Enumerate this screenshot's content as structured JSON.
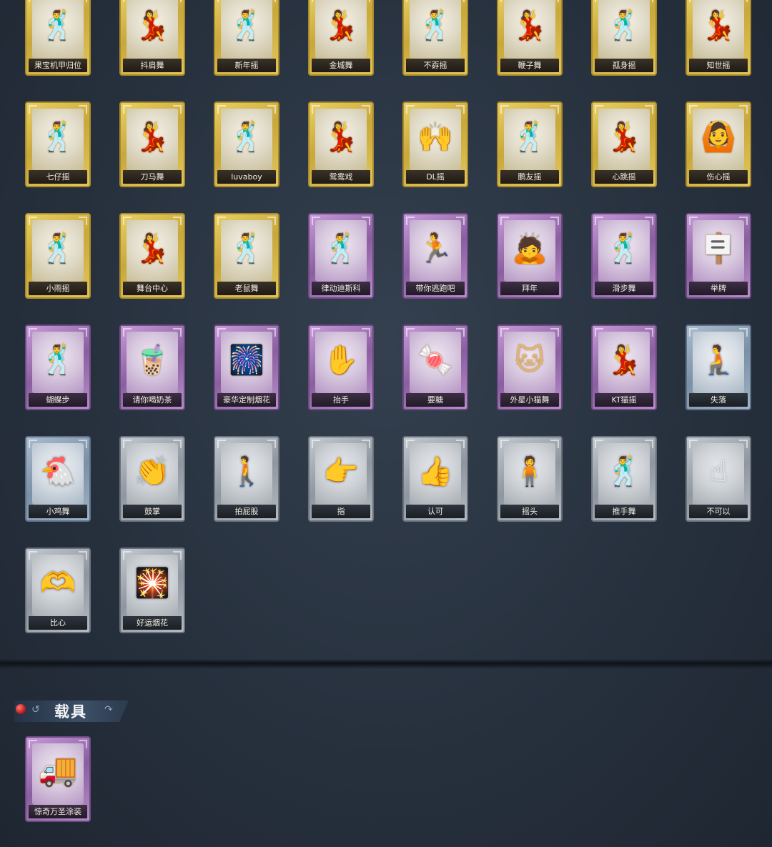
{
  "emotes": [
    {
      "label": "果宝机甲归位",
      "rarity": "gold",
      "icon": "🕺"
    },
    {
      "label": "抖肩舞",
      "rarity": "gold",
      "icon": "💃"
    },
    {
      "label": "新年摇",
      "rarity": "gold",
      "icon": "🕺"
    },
    {
      "label": "金城舞",
      "rarity": "gold",
      "icon": "💃"
    },
    {
      "label": "不孬摇",
      "rarity": "gold",
      "icon": "🕺"
    },
    {
      "label": "鞭子舞",
      "rarity": "gold",
      "icon": "💃"
    },
    {
      "label": "孤身摇",
      "rarity": "gold",
      "icon": "🕺"
    },
    {
      "label": "知世摇",
      "rarity": "gold",
      "icon": "💃"
    },
    {
      "label": "七仔摇",
      "rarity": "gold",
      "icon": "🕺"
    },
    {
      "label": "刀马舞",
      "rarity": "gold",
      "icon": "💃"
    },
    {
      "label": "luvaboy",
      "rarity": "gold",
      "icon": "🕺"
    },
    {
      "label": "鸳鸯戏",
      "rarity": "gold",
      "icon": "💃"
    },
    {
      "label": "DL摇",
      "rarity": "gold",
      "icon": "🙌"
    },
    {
      "label": "鹏友摇",
      "rarity": "gold",
      "icon": "🕺"
    },
    {
      "label": "心跳摇",
      "rarity": "gold",
      "icon": "💃"
    },
    {
      "label": "伤心摇",
      "rarity": "gold",
      "icon": "🙆"
    },
    {
      "label": "小雨摇",
      "rarity": "gold",
      "icon": "🕺"
    },
    {
      "label": "舞台中心",
      "rarity": "gold",
      "icon": "💃"
    },
    {
      "label": "老鼠舞",
      "rarity": "gold",
      "icon": "🕺"
    },
    {
      "label": "律动迪斯科",
      "rarity": "purple",
      "icon": "🕺"
    },
    {
      "label": "带你逃跑吧",
      "rarity": "purple",
      "icon": "🏃"
    },
    {
      "label": "拜年",
      "rarity": "purple",
      "icon": "🙇"
    },
    {
      "label": "滑步舞",
      "rarity": "purple",
      "icon": "🕺"
    },
    {
      "label": "举牌",
      "rarity": "purple",
      "icon": "🪧"
    },
    {
      "label": "蝴蝶步",
      "rarity": "purple",
      "icon": "🕺"
    },
    {
      "label": "请你喝奶茶",
      "rarity": "purple",
      "icon": "🧋"
    },
    {
      "label": "豪华定制烟花",
      "rarity": "purple",
      "icon": "🎆"
    },
    {
      "label": "抬手",
      "rarity": "purple",
      "icon": "✋"
    },
    {
      "label": "要糖",
      "rarity": "purple",
      "icon": "🍬"
    },
    {
      "label": "外星小猫舞",
      "rarity": "purple",
      "icon": "🐱"
    },
    {
      "label": "KT猫摇",
      "rarity": "purple",
      "icon": "💃"
    },
    {
      "label": "失落",
      "rarity": "blue",
      "icon": "🧎"
    },
    {
      "label": "小鸡舞",
      "rarity": "blue",
      "icon": "🐔"
    },
    {
      "label": "鼓掌",
      "rarity": "silver",
      "icon": "👏"
    },
    {
      "label": "拍屁股",
      "rarity": "silver",
      "icon": "🚶"
    },
    {
      "label": "指",
      "rarity": "silver",
      "icon": "👉"
    },
    {
      "label": "认可",
      "rarity": "silver",
      "icon": "👍"
    },
    {
      "label": "摇头",
      "rarity": "silver",
      "icon": "🧍"
    },
    {
      "label": "推手舞",
      "rarity": "silver",
      "icon": "🕺"
    },
    {
      "label": "不可以",
      "rarity": "silver",
      "icon": "☝"
    },
    {
      "label": "比心",
      "rarity": "silver",
      "icon": "🫶"
    },
    {
      "label": "好运烟花",
      "rarity": "silver",
      "icon": "🎇"
    }
  ],
  "vehicles_section": {
    "title": "载具",
    "items": [
      {
        "label": "惊奇万圣涂装",
        "rarity": "purple",
        "icon": "🚚"
      }
    ]
  }
}
